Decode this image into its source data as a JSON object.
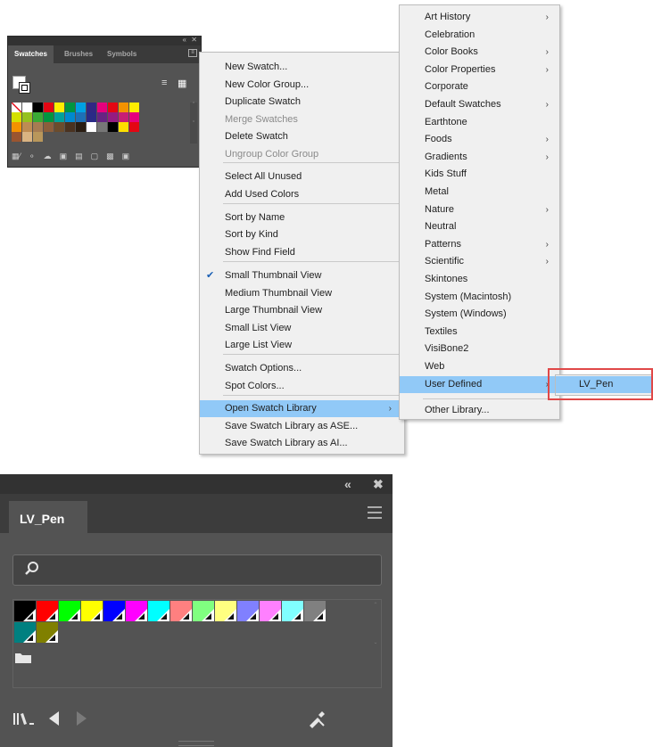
{
  "small_panel": {
    "tabs": [
      "Swatches",
      "Brushes",
      "Symbols"
    ],
    "swatch_rows": [
      [
        "#ffffff",
        "#ffffff",
        "#000000",
        "#e30613",
        "#ffed00",
        "#009640",
        "#00a0e3",
        "#312783",
        "#e5007d",
        "#e30613",
        "#f39200",
        "#ffed00"
      ],
      [
        "#d4e000",
        "#95c11f",
        "#3aaa35",
        "#009640",
        "#00a19a",
        "#0089cf",
        "#1d70b7",
        "#2a2a86",
        "#662483",
        "#951b81",
        "#c71d75",
        "#e6007e"
      ],
      [
        "#f39200",
        "#be8c52",
        "#a67c52",
        "#8b5e3c",
        "#6b4c2d",
        "#4a3220",
        "#2a1d12",
        "#ffffff",
        "#777777",
        "#000000",
        "#fde000",
        "#e30613"
      ],
      [
        "#9a5530",
        "#d9b382",
        "#b9975b"
      ]
    ]
  },
  "menu": {
    "items": [
      {
        "label": "New Swatch...",
        "state": "normal"
      },
      {
        "label": "New Color Group...",
        "state": "normal"
      },
      {
        "label": "Duplicate Swatch",
        "state": "normal"
      },
      {
        "label": "Merge Swatches",
        "state": "disabled"
      },
      {
        "label": "Delete Swatch",
        "state": "normal"
      },
      {
        "label": "Ungroup Color Group",
        "state": "disabled"
      },
      {
        "label": "Select All Unused",
        "state": "normal"
      },
      {
        "label": "Add Used Colors",
        "state": "normal"
      },
      {
        "label": "Sort by Name",
        "state": "normal"
      },
      {
        "label": "Sort by Kind",
        "state": "normal"
      },
      {
        "label": "Show Find Field",
        "state": "normal"
      },
      {
        "label": "Small Thumbnail View",
        "state": "checked"
      },
      {
        "label": "Medium Thumbnail View",
        "state": "normal"
      },
      {
        "label": "Large Thumbnail View",
        "state": "normal"
      },
      {
        "label": "Small List View",
        "state": "normal"
      },
      {
        "label": "Large List View",
        "state": "normal"
      },
      {
        "label": "Swatch Options...",
        "state": "normal"
      },
      {
        "label": "Spot Colors...",
        "state": "normal"
      },
      {
        "label": "Open Swatch Library",
        "state": "highlighted",
        "submenu": true
      },
      {
        "label": "Save Swatch Library as ASE...",
        "state": "normal"
      },
      {
        "label": "Save Swatch Library as AI...",
        "state": "normal"
      }
    ]
  },
  "library_menu": {
    "items": [
      {
        "label": "Art History",
        "submenu": true
      },
      {
        "label": "Celebration",
        "submenu": false
      },
      {
        "label": "Color Books",
        "submenu": true
      },
      {
        "label": "Color Properties",
        "submenu": true
      },
      {
        "label": "Corporate",
        "submenu": false
      },
      {
        "label": "Default Swatches",
        "submenu": true
      },
      {
        "label": "Earthtone",
        "submenu": false
      },
      {
        "label": "Foods",
        "submenu": true
      },
      {
        "label": "Gradients",
        "submenu": true
      },
      {
        "label": "Kids Stuff",
        "submenu": false
      },
      {
        "label": "Metal",
        "submenu": false
      },
      {
        "label": "Nature",
        "submenu": true
      },
      {
        "label": "Neutral",
        "submenu": false
      },
      {
        "label": "Patterns",
        "submenu": true
      },
      {
        "label": "Scientific",
        "submenu": true
      },
      {
        "label": "Skintones",
        "submenu": false
      },
      {
        "label": "System (Macintosh)",
        "submenu": false
      },
      {
        "label": "System (Windows)",
        "submenu": false
      },
      {
        "label": "Textiles",
        "submenu": false
      },
      {
        "label": "VisiBone2",
        "submenu": false
      },
      {
        "label": "Web",
        "submenu": false
      },
      {
        "label": "User Defined",
        "submenu": true,
        "highlighted": true
      },
      {
        "label": "Other Library...",
        "submenu": false
      }
    ]
  },
  "user_defined_menu": {
    "item": "LV_Pen"
  },
  "library_panel": {
    "tab": "LV_Pen",
    "search_placeholder": "",
    "swatches": [
      "#000000",
      "#ff0000",
      "#00ff00",
      "#ffff00",
      "#0000ff",
      "#ff00ff",
      "#00ffff",
      "#ff8080",
      "#80ff80",
      "#ffff80",
      "#8080ff",
      "#ff80ff",
      "#80ffff",
      "#808080",
      "#008080",
      "#808000"
    ]
  },
  "colors": {
    "menu_bg": "#f0f0f0",
    "highlight": "#91c9f7",
    "panel_bg": "#535353",
    "annotation": "#e04848"
  }
}
